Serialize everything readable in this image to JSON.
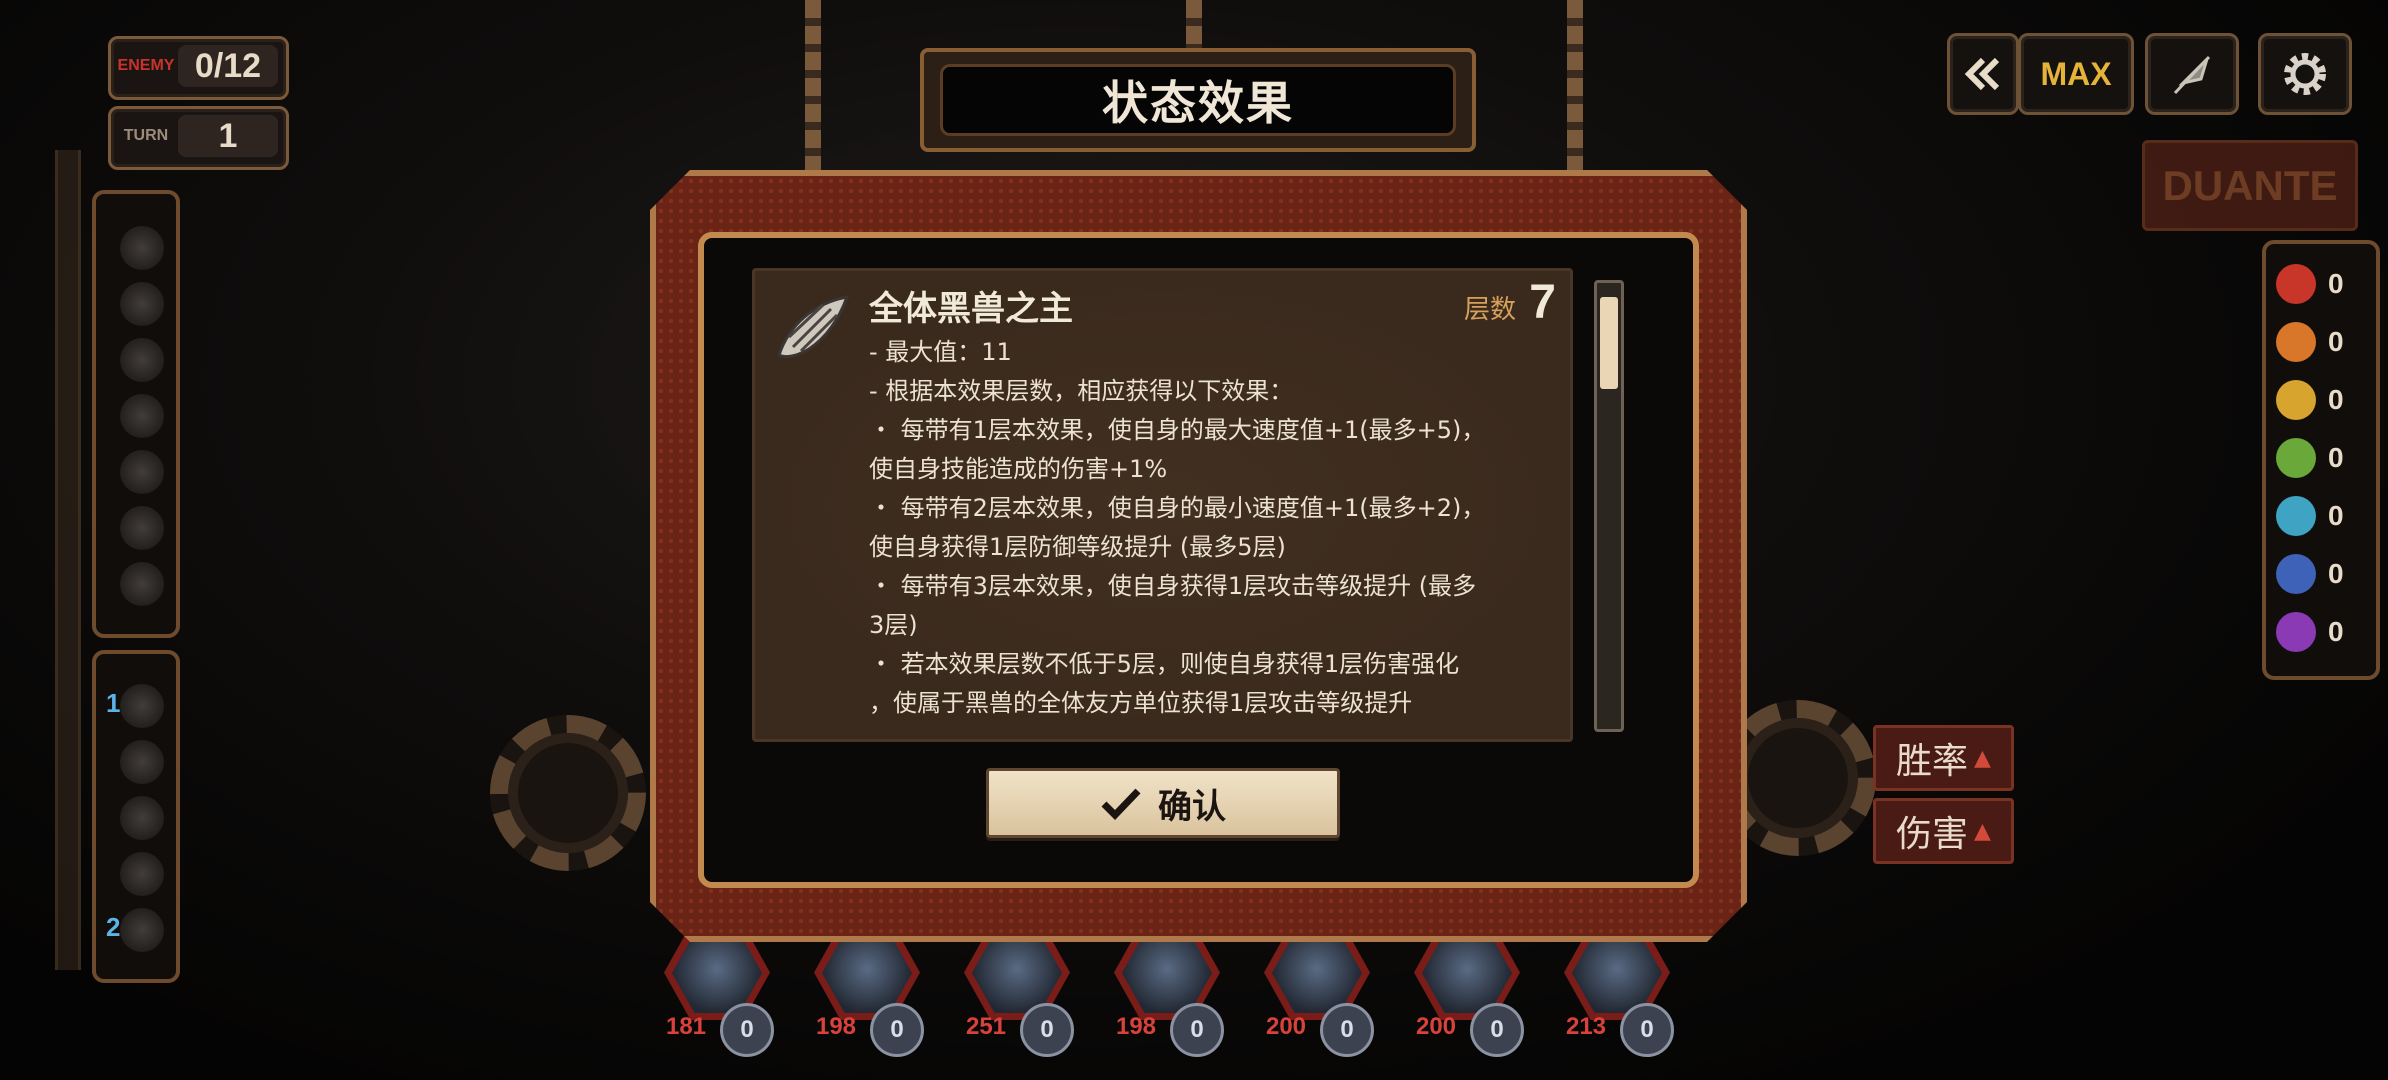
{
  "hud": {
    "enemy_tag": "ENEMY",
    "enemy_count": "0/12",
    "turn_tag": "TURN",
    "turn_value": "1"
  },
  "controls": {
    "rewind_icon": "double-chevron-left-icon",
    "speed_label": "MAX",
    "auto_icon": "feather-icon",
    "settings_icon": "gear-icon",
    "dante_label": "DUANTE"
  },
  "left_panel_bottom": {
    "num1": "1",
    "num2": "2"
  },
  "elements": [
    {
      "icon": "wrath-icon",
      "color": "#c8362a",
      "count": "0"
    },
    {
      "icon": "lust-icon",
      "color": "#d8772a",
      "count": "0"
    },
    {
      "icon": "sloth-icon",
      "color": "#d7a52e",
      "count": "0"
    },
    {
      "icon": "gluttony-icon",
      "color": "#6aa83a",
      "count": "0"
    },
    {
      "icon": "gloom-icon",
      "color": "#3fa3c4",
      "count": "0"
    },
    {
      "icon": "pride-icon",
      "color": "#3d62b8",
      "count": "0"
    },
    {
      "icon": "envy-icon",
      "color": "#8a3ab5",
      "count": "0"
    }
  ],
  "side_buttons": {
    "win_rate": "胜率",
    "damage": "伤害"
  },
  "modal": {
    "title": "状态效果",
    "status_name": "全体黑兽之主",
    "stack_label": "层数",
    "stack_value": "7",
    "lines": [
      "- 最大值：11",
      "- 根据本效果层数，相应获得以下效果：",
      "・ 每带有1层本效果，使自身的最大速度值+1(最多+5)，",
      "使自身技能造成的伤害+1%",
      "・ 每带有2层本效果，使自身的最小速度值+1(最多+2)，",
      "使自身获得1层防御等级提升 (最多5层)",
      "・ 每带有3层本效果，使自身获得1层攻击等级提升 (最多",
      "3层)",
      "・ 若本效果层数不低于5层，则使自身获得1层伤害强化",
      "，使属于黑兽的全体友方单位获得1层攻击等级提升"
    ],
    "confirm_label": "确认",
    "scroll_position": 0.05
  },
  "party": [
    {
      "hp": "181",
      "sp": "0"
    },
    {
      "hp": "198",
      "sp": "0"
    },
    {
      "hp": "251",
      "sp": "0"
    },
    {
      "hp": "198",
      "sp": "0"
    },
    {
      "hp": "200",
      "sp": "0"
    },
    {
      "hp": "200",
      "sp": "0"
    },
    {
      "hp": "213",
      "sp": "0"
    }
  ]
}
